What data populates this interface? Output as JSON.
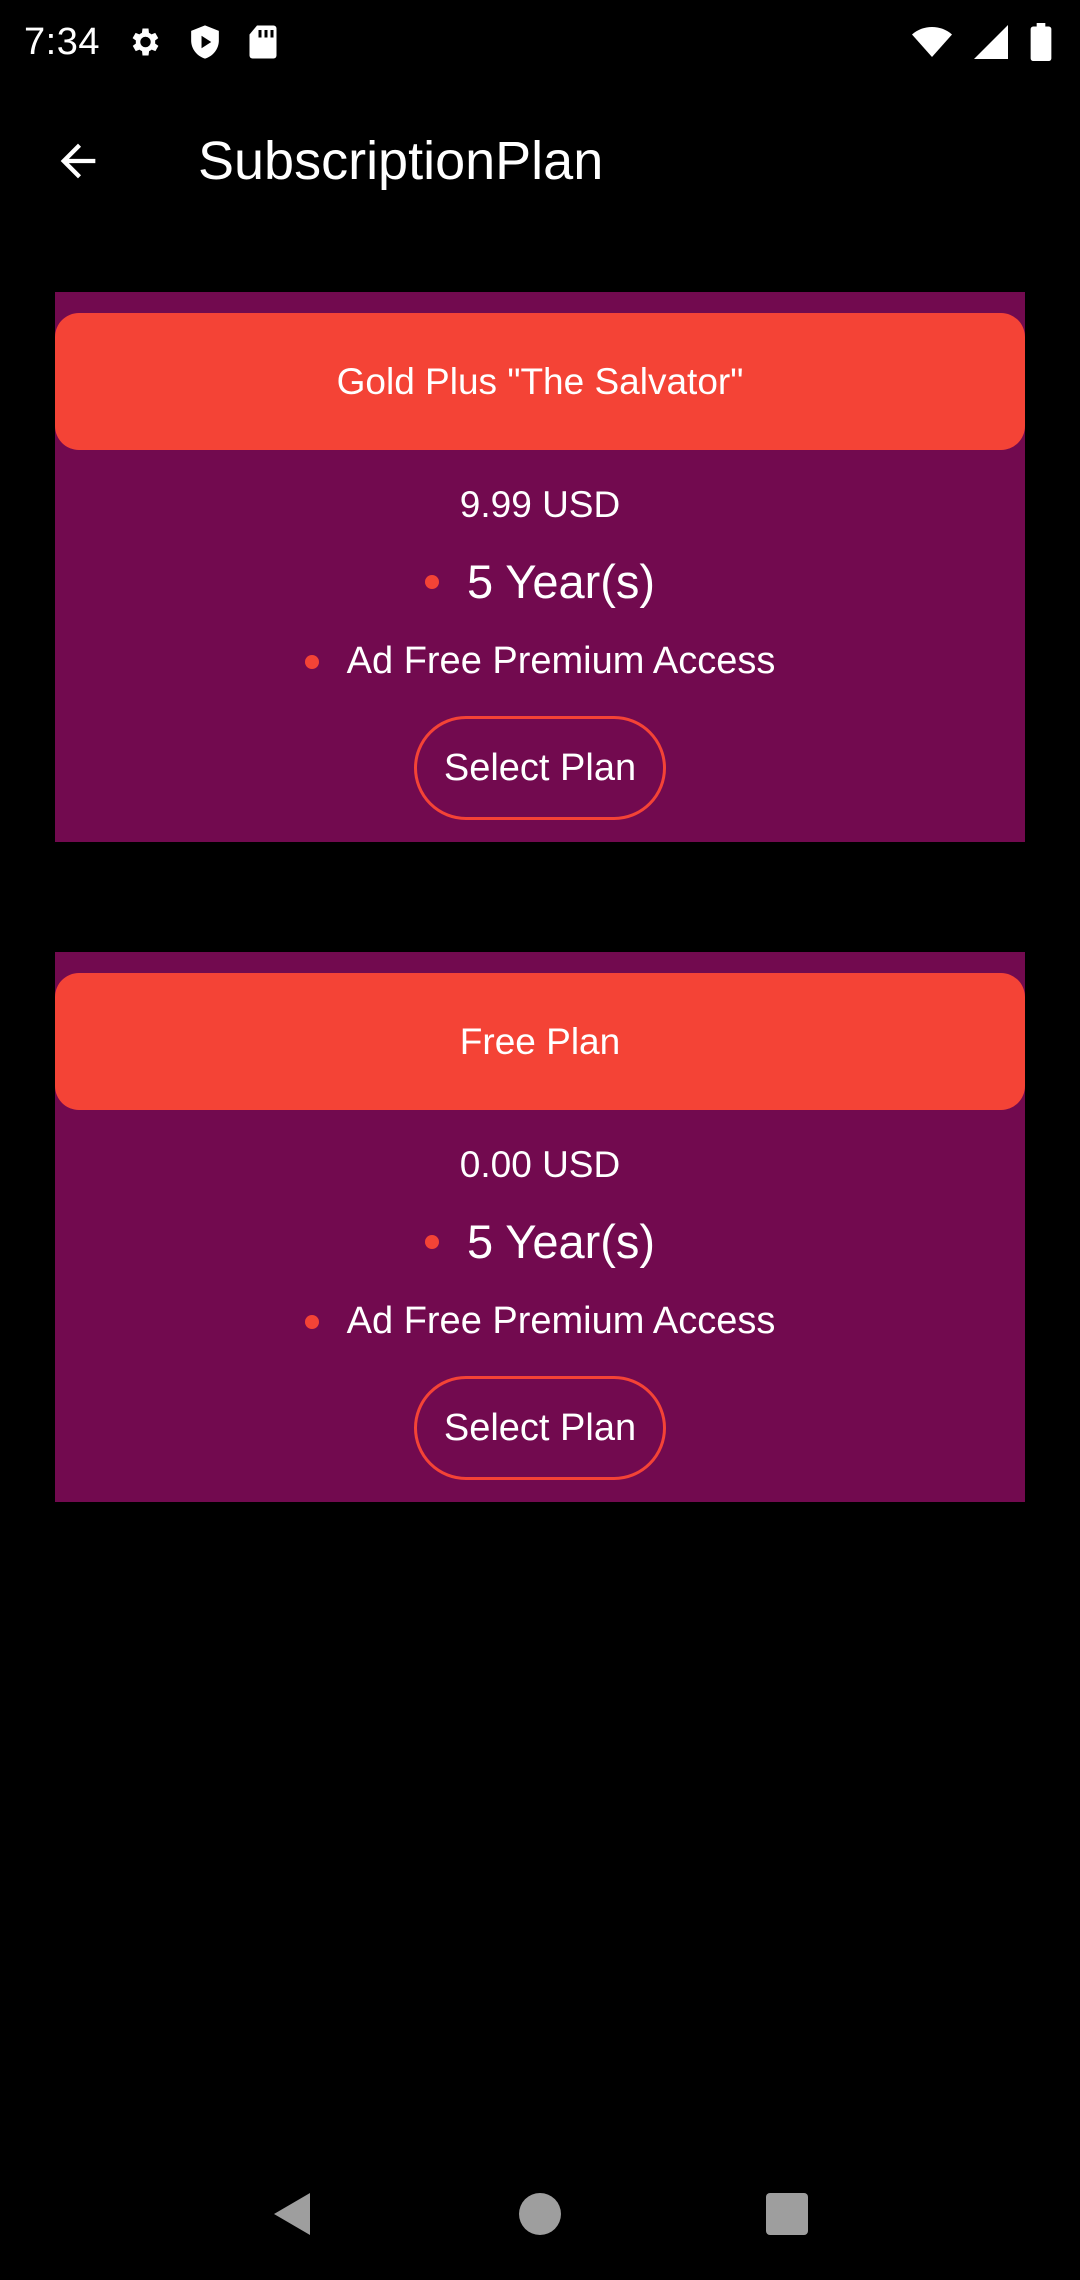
{
  "status_bar": {
    "time": "7:34",
    "icons_left": [
      "gear-icon",
      "shield-play-icon",
      "sd-card-icon"
    ],
    "icons_right": [
      "wifi-icon",
      "signal-icon",
      "battery-icon"
    ]
  },
  "app_bar": {
    "title": "SubscriptionPlan",
    "back_icon": "arrow-left-icon"
  },
  "plans": [
    {
      "name": "Gold Plus \"The Salvator\"",
      "price": "9.99 USD",
      "duration": "5 Year(s)",
      "feature": "Ad Free Premium Access",
      "button_label": "Select Plan"
    },
    {
      "name": "Free Plan",
      "price": "0.00 USD",
      "duration": "5 Year(s)",
      "feature": "Ad Free Premium Access",
      "button_label": "Select Plan"
    }
  ],
  "colors": {
    "background": "#000000",
    "card": "#720a4f",
    "accent": "#f44336",
    "text": "#ffffff"
  },
  "nav_bar": {
    "icons": [
      "back-triangle-icon",
      "home-circle-icon",
      "recents-square-icon"
    ]
  }
}
